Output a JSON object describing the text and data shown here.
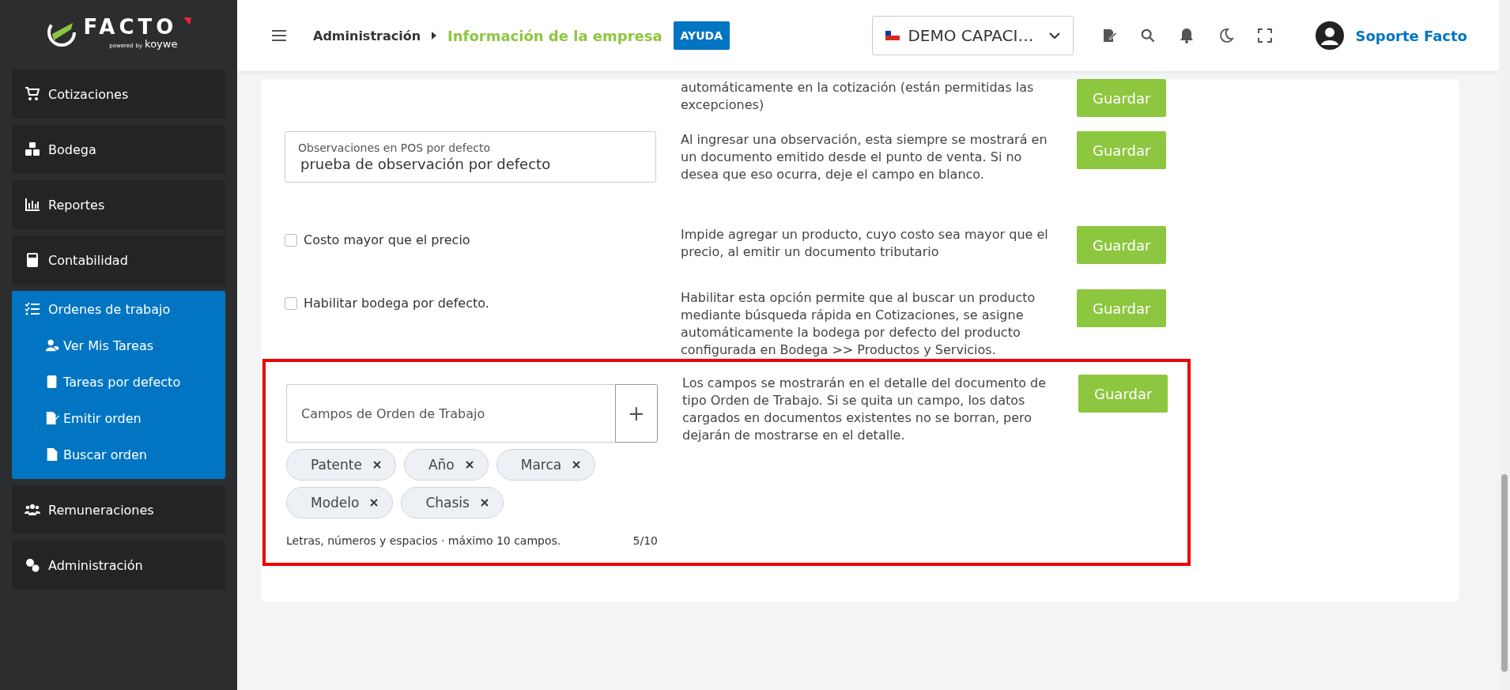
{
  "sidebar": {
    "logo": {
      "name": "FACTO",
      "powered": "powered",
      "by": "by",
      "brand": "koywe"
    },
    "items": [
      {
        "label": "Cotizaciones",
        "selected": false
      },
      {
        "label": "Bodega",
        "selected": false
      },
      {
        "label": "Reportes",
        "selected": false
      },
      {
        "label": "Contabilidad",
        "selected": false
      },
      {
        "label": "Ordenes de trabajo",
        "selected": true,
        "expanded": true,
        "children": [
          {
            "label": "Ver Mis Tareas"
          },
          {
            "label": "Tareas por defecto"
          },
          {
            "label": "Emitir orden"
          },
          {
            "label": "Buscar orden"
          }
        ]
      },
      {
        "label": "Remuneraciones",
        "selected": false
      },
      {
        "label": "Administración",
        "selected": false
      }
    ]
  },
  "header": {
    "breadcrumb": [
      "Administración",
      "Información de la empresa"
    ],
    "help": "AYUDA",
    "company": "DEMO CAPACI…",
    "user": "Soporte Facto"
  },
  "rows": [
    {
      "kind": "text",
      "description": "automáticamente en la cotización (están permitidas las excepciones)",
      "button": "Guardar",
      "highlighted": false
    },
    {
      "kind": "field",
      "label": "Observaciones en POS por defecto",
      "value": "prueba de observación por defecto",
      "description": "Al ingresar una observación, esta siempre se mostrará en un documento emitido desde el punto de venta. Si no desea que eso ocurra, deje el campo en blanco.",
      "button": "Guardar",
      "highlighted": false
    },
    {
      "kind": "checkbox",
      "label": "Costo mayor que el precio",
      "checked": false,
      "description": "Impide agregar un producto, cuyo costo sea mayor que el precio, al emitir un documento tributario",
      "button": "Guardar",
      "highlighted": false
    },
    {
      "kind": "checkbox",
      "label": "Habilitar bodega por defecto.",
      "checked": false,
      "description": "Habilitar esta opción permite que al buscar un producto mediante búsqueda rápida en Cotizaciones, se asigne automáticamente la bodega por defecto del producto configurada en Bodega >> Productos y Servicios.",
      "button": "Guardar",
      "highlighted": false
    },
    {
      "kind": "tags",
      "placeholder": "Campos de Orden de Trabajo",
      "add": "+",
      "tags": [
        "Patente",
        "Año",
        "Marca",
        "Modelo",
        "Chasis"
      ],
      "hint": "Letras, números y espacios · máximo 10 campos.",
      "count": "5/10",
      "description": "Los campos se mostrarán en el detalle del documento de tipo Orden de Trabajo. Si se quita un campo, los datos cargados en documentos existentes no se borran, pero dejarán de mostrarse en el detalle.",
      "button": "Guardar",
      "highlighted": true
    }
  ]
}
